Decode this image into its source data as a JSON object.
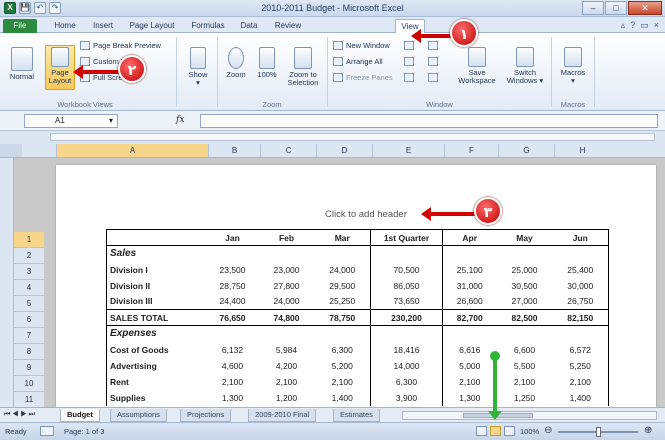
{
  "window": {
    "title": "2010-2011 Budget - Microsoft Excel"
  },
  "qat": {
    "save": "💾",
    "undo": "↶",
    "redo": "↷"
  },
  "tabs": [
    "File",
    "Home",
    "Insert",
    "Page Layout",
    "Formulas",
    "Data",
    "Review",
    "View"
  ],
  "ribbon": {
    "workbook_views": {
      "label": "Workbook Views",
      "normal": "Normal",
      "page_layout_1": "Page",
      "page_layout_2": "Layout",
      "page_break_preview": "Page Break Preview",
      "custom_views": "Custom Views",
      "full_screen": "Full Screen"
    },
    "show": {
      "label": "Show"
    },
    "zoom": {
      "label": "Zoom",
      "zoom": "Zoom",
      "hundred": "100%",
      "zoom_selection_1": "Zoom to",
      "zoom_selection_2": "Selection"
    },
    "window": {
      "label": "Window",
      "new_window": "New Window",
      "arrange_all": "Arrange All",
      "freeze_panes": "Freeze Panes",
      "save_workspace_1": "Save",
      "save_workspace_2": "Workspace",
      "switch_windows_1": "Switch",
      "switch_windows_2": "Windows"
    },
    "macros": {
      "label": "Macros",
      "button": "Macros"
    }
  },
  "formula_bar": {
    "name_box": "A1",
    "fx": "fx",
    "value": ""
  },
  "columns": [
    "A",
    "B",
    "C",
    "D",
    "E",
    "F",
    "G",
    "H"
  ],
  "rows": [
    "1",
    "2",
    "3",
    "4",
    "5",
    "6",
    "7",
    "8",
    "9",
    "10",
    "11"
  ],
  "page": {
    "header_hint": "Click to add header"
  },
  "table": {
    "headers": [
      "Jan",
      "Feb",
      "Mar",
      "1st Quarter",
      "Apr",
      "May",
      "Jun"
    ],
    "sales_section": "Sales",
    "expenses_section": "Expenses",
    "sales_rows": [
      {
        "label": "Division I",
        "values": [
          "23,500",
          "23,000",
          "24,000",
          "70,500",
          "25,100",
          "25,000",
          "25,400"
        ]
      },
      {
        "label": "Division II",
        "values": [
          "28,750",
          "27,800",
          "29,500",
          "86,050",
          "31,000",
          "30,500",
          "30,000"
        ]
      },
      {
        "label": "Division III",
        "values": [
          "24,400",
          "24,000",
          "25,250",
          "73,650",
          "26,600",
          "27,000",
          "26,750"
        ]
      }
    ],
    "sales_total": {
      "label": "SALES TOTAL",
      "values": [
        "76,650",
        "74,800",
        "78,750",
        "230,200",
        "82,700",
        "82,500",
        "82,150"
      ]
    },
    "expense_rows": [
      {
        "label": "Cost of Goods",
        "values": [
          "6,132",
          "5,984",
          "6,300",
          "18,416",
          "6,616",
          "6,600",
          "6,572"
        ]
      },
      {
        "label": "Advertising",
        "values": [
          "4,600",
          "4,200",
          "5,200",
          "14,000",
          "5,000",
          "5,500",
          "5,250"
        ]
      },
      {
        "label": "Rent",
        "values": [
          "2,100",
          "2,100",
          "2,100",
          "6,300",
          "2,100",
          "2,100",
          "2,100"
        ]
      },
      {
        "label": "Supplies",
        "values": [
          "1,300",
          "1,200",
          "1,400",
          "3,900",
          "1,300",
          "1,250",
          "1,400"
        ]
      }
    ]
  },
  "sheet_tabs": [
    "Budget",
    "Assumptions",
    "Projections",
    "2009-2010 Final",
    "Estimates"
  ],
  "status": {
    "ready": "Ready",
    "page": "Page: 1 of 3",
    "zoom": "100%"
  },
  "callouts": {
    "one": "١",
    "two": "٢",
    "three": "٣"
  },
  "colors": {
    "accent": "#d00000",
    "green_arrow": "#33b23a",
    "file_tab": "#2b8a3e"
  }
}
